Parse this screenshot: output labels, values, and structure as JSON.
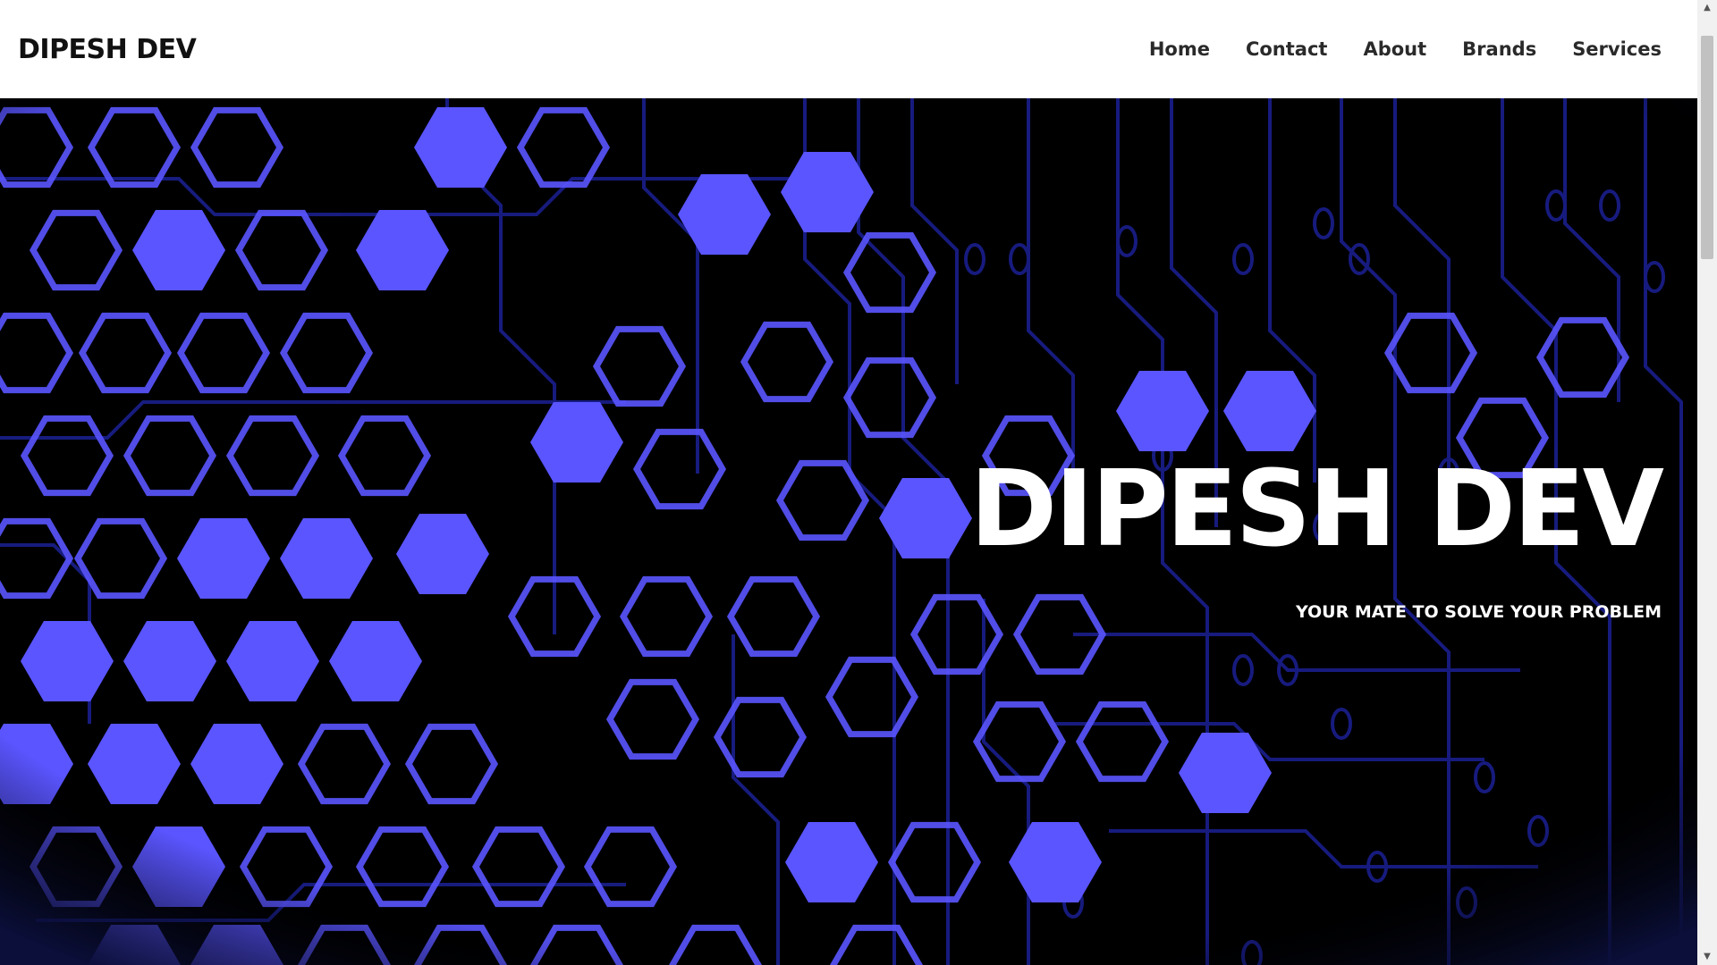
{
  "header": {
    "brand": "DIPESH DEV",
    "nav": [
      {
        "label": "Home"
      },
      {
        "label": "Contact"
      },
      {
        "label": "About"
      },
      {
        "label": "Brands"
      },
      {
        "label": "Services"
      }
    ]
  },
  "hero": {
    "title": "DIPESH DEV",
    "subtitle": "YOUR MATE TO SOLVE YOUR PROBLEM"
  },
  "colors": {
    "background": "#000000",
    "hex_fill": "#5a55ff",
    "hex_stroke": "#5a55ff",
    "circuit": "#1a1f8c",
    "text": "#ffffff",
    "nav_text": "#2a2a2a"
  },
  "scrollbar": {
    "up_icon": "triangle-up",
    "down_icon": "triangle-down"
  }
}
